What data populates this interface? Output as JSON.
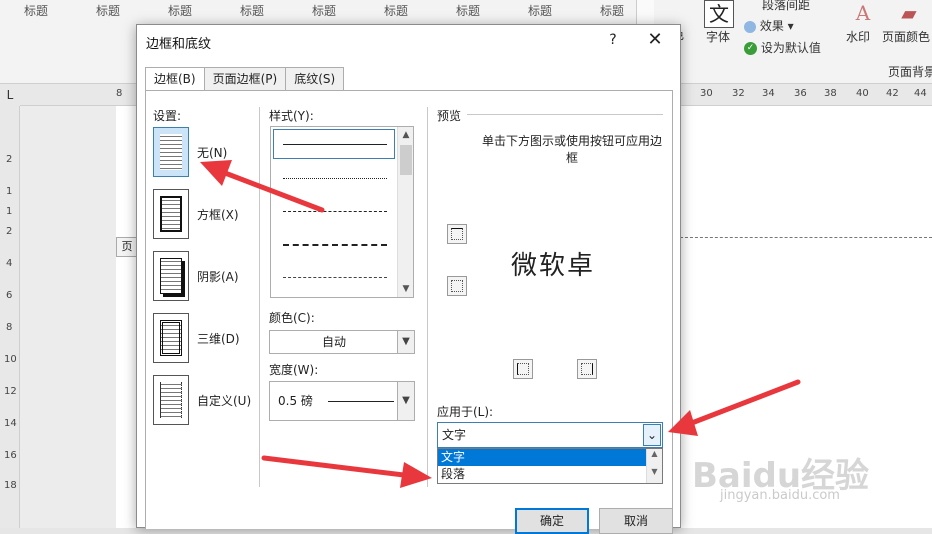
{
  "ribbon": {
    "styles": [
      "标题",
      "标题",
      "标题",
      "标题",
      "标题",
      "标题",
      "标题",
      "标题",
      "标题"
    ],
    "font_label": "字体",
    "color_label": "色",
    "paragraph_spacing": "段落间距",
    "effects": "效果",
    "set_default": "设为默认值",
    "watermark": "水印",
    "page_color": "页面颜色",
    "page_background": "页面背景"
  },
  "ruler": {
    "corner": "L",
    "left_nums": [
      "8"
    ],
    "right_nums": [
      "30",
      "32",
      "34",
      "36",
      "38",
      "40",
      "42",
      "44"
    ],
    "vertical_nums": [
      "2",
      "1",
      "1",
      "2",
      "4",
      "6",
      "8",
      "10",
      "12",
      "14",
      "16",
      "18"
    ]
  },
  "page": {
    "page_label": "页"
  },
  "dialog": {
    "title": "边框和底纹",
    "help": "?",
    "close": "✕",
    "tabs": [
      "边框(B)",
      "页面边框(P)",
      "底纹(S)"
    ],
    "settings_label": "设置:",
    "settings": [
      "无(N)",
      "方框(X)",
      "阴影(A)",
      "三维(D)",
      "自定义(U)"
    ],
    "style_label": "样式(Y):",
    "color_label": "颜色(C):",
    "color_value": "自动",
    "width_label": "宽度(W):",
    "width_value": "0.5 磅",
    "preview_label": "预览",
    "preview_instructions": "单击下方图示或使用按钮可应用边框",
    "preview_sample": "微软卓",
    "apply_label": "应用于(L):",
    "apply_value": "文字",
    "apply_options": [
      "文字",
      "段落"
    ],
    "ok": "确定",
    "cancel": "取消"
  },
  "watermark_overlay": {
    "brand": "Baidu经验",
    "url": "jingyan.baidu.com"
  },
  "colors": {
    "accent": "#0078d7",
    "arrow": "#e8383d",
    "selected_setting": "#cce4f7"
  }
}
